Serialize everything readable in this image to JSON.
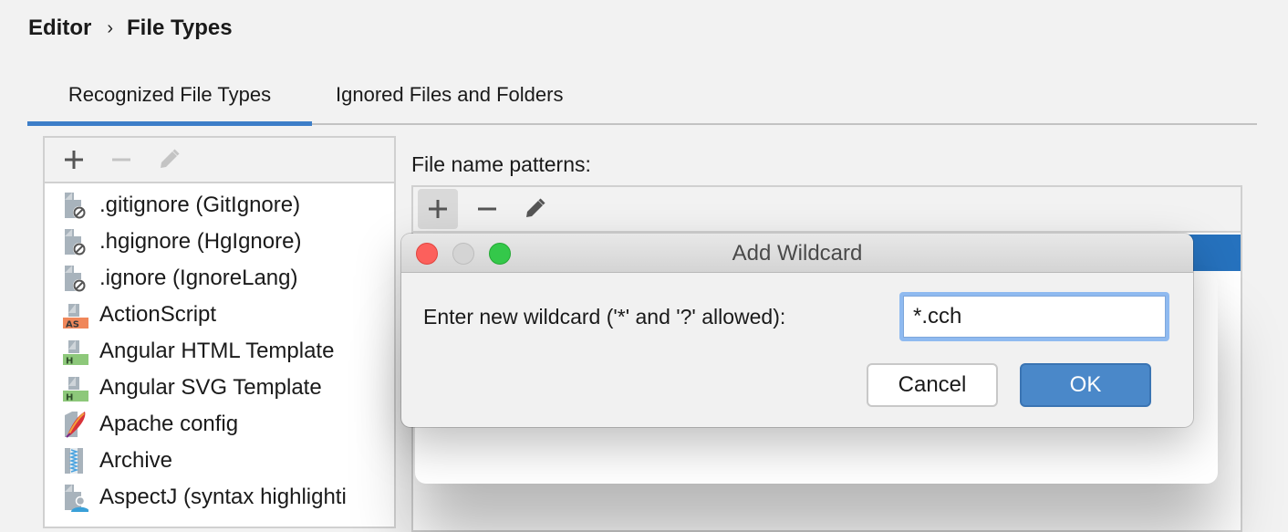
{
  "breadcrumb": {
    "items": [
      "Editor",
      "File Types"
    ],
    "separator": "›"
  },
  "tabs": [
    {
      "label": "Recognized File Types",
      "active": true
    },
    {
      "label": "Ignored Files and Folders",
      "active": false
    }
  ],
  "file_types": {
    "toolbar": {
      "add": "add-icon",
      "remove": "remove-icon",
      "edit": "edit-icon"
    },
    "items": [
      {
        "label": ".gitignore (GitIgnore)",
        "icon": "ignore-file-icon"
      },
      {
        "label": ".hgignore (HgIgnore)",
        "icon": "ignore-file-icon"
      },
      {
        "label": ".ignore (IgnoreLang)",
        "icon": "ignore-file-icon"
      },
      {
        "label": "ActionScript",
        "icon": "actionscript-file-icon",
        "badge": "AS"
      },
      {
        "label": "Angular HTML Template",
        "icon": "html-file-icon",
        "badge": "H"
      },
      {
        "label": "Angular SVG Template",
        "icon": "html-file-icon",
        "badge": "H"
      },
      {
        "label": "Apache config",
        "icon": "apache-feather-icon"
      },
      {
        "label": "Archive",
        "icon": "archive-zip-icon"
      },
      {
        "label": "AspectJ (syntax highlighti",
        "icon": "aspectj-file-icon"
      }
    ]
  },
  "patterns": {
    "label": "File name patterns:",
    "toolbar": {
      "add": "add-icon",
      "remove": "remove-icon",
      "edit": "edit-icon"
    }
  },
  "dialog": {
    "title": "Add Wildcard",
    "prompt": "Enter new wildcard ('*' and '?' allowed):",
    "input_value": "*.cch",
    "cancel_label": "Cancel",
    "ok_label": "OK"
  },
  "colors": {
    "accent": "#3d7ec8",
    "selection": "#2672be",
    "ok_button": "#4a88c9",
    "close_light": "#fc605c",
    "zoom_light": "#34c84a",
    "actionscript_badge": "#f0875a",
    "html_badge": "#8dc87a"
  }
}
